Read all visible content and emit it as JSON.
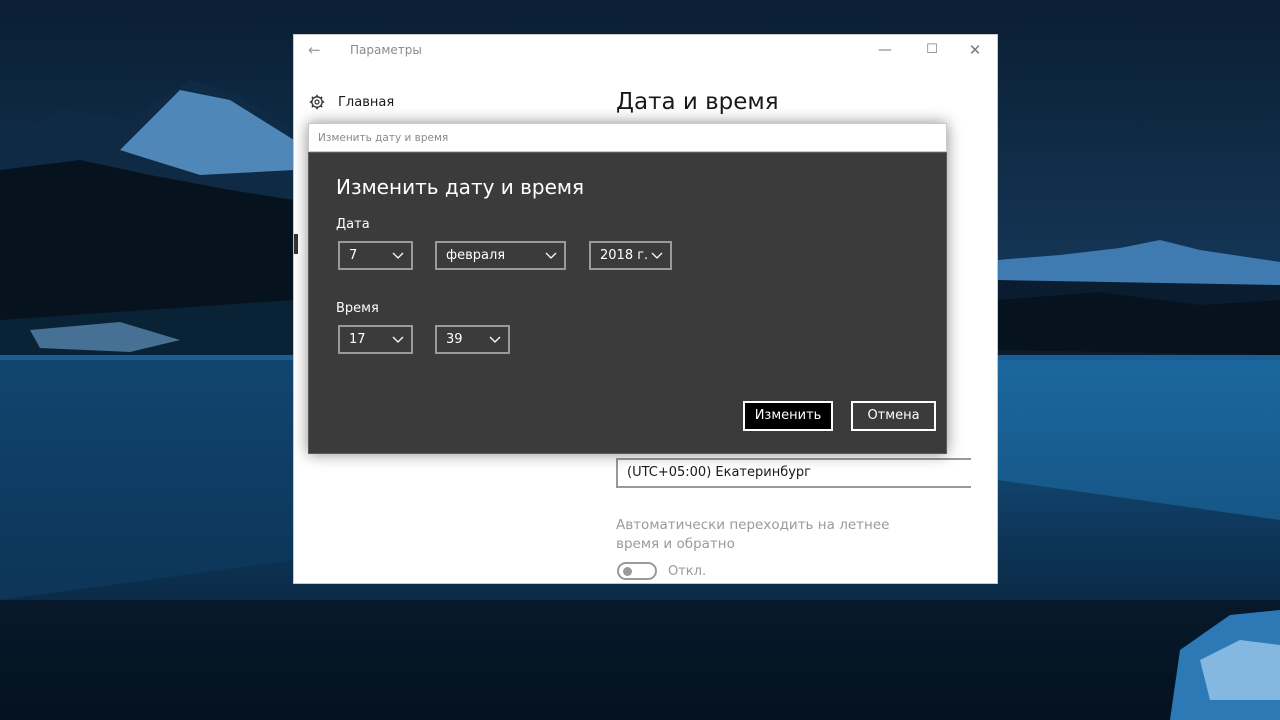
{
  "window": {
    "title": "Параметры",
    "back_icon": "arrow-left-icon",
    "controls": [
      "minimize-icon",
      "maximize-icon",
      "close-icon"
    ]
  },
  "nav": {
    "home_label": "Главная",
    "home_icon": "gear-icon"
  },
  "page": {
    "title": "Дата и время",
    "timezone_value": "(UTC+05:00) Екатеринбург",
    "dst_label": "Автоматически переходить на летнее время и обратно",
    "dst_toggle_state": "Откл.",
    "dst_enabled": false
  },
  "dialog": {
    "titlebar": "Изменить дату и время",
    "heading": "Изменить дату и время",
    "date_label": "Дата",
    "time_label": "Время",
    "day": "7",
    "month": "февраля",
    "year": "2018 г.",
    "hour": "17",
    "minute": "39",
    "ok_label": "Изменить",
    "cancel_label": "Отмена"
  },
  "colors": {
    "dialog_bg": "#3b3b3b",
    "window_bg": "#ffffff",
    "primary_button_bg": "#000000"
  }
}
